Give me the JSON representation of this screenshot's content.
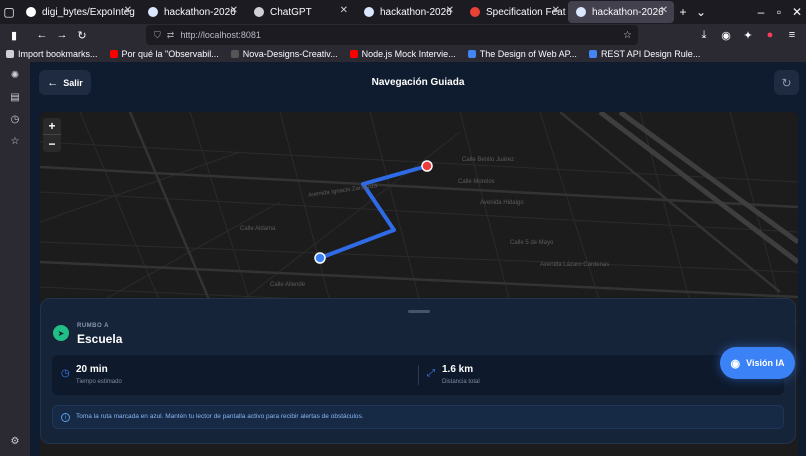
{
  "browser": {
    "tabs": [
      {
        "label": "digi_bytes/ExpoInteg",
        "icon": "github-icon",
        "color": "#ffffff"
      },
      {
        "label": "hackathon-2026",
        "icon": "app-icon",
        "color": "#dbe7ff"
      },
      {
        "label": "ChatGPT",
        "icon": "chatgpt-icon",
        "color": "#cfcfd8"
      },
      {
        "label": "hackathon-2026",
        "icon": "app-icon",
        "color": "#dbe7ff"
      },
      {
        "label": "Specification Feature",
        "icon": "gmail-icon",
        "color": "#ea4335"
      },
      {
        "label": "hackathon-2026",
        "icon": "app-icon",
        "color": "#dbe7ff"
      }
    ],
    "active_tab_index": 5,
    "url": "http://localhost:8081",
    "bookmarks": [
      {
        "label": "Import bookmarks...",
        "icon": "import-icon",
        "color": "#cfcfd8"
      },
      {
        "label": "Por qué la \"Observabil...",
        "icon": "youtube-icon",
        "color": "#ff0000"
      },
      {
        "label": "Nova-Designs-Creativ...",
        "icon": "github-icon",
        "color": "#555555"
      },
      {
        "label": "Node.js Mock Intervie...",
        "icon": "youtube-icon",
        "color": "#ff0000"
      },
      {
        "label": "The Design of Web AP...",
        "icon": "google-icon",
        "color": "#4285f4"
      },
      {
        "label": "REST API Design Rule...",
        "icon": "google-icon",
        "color": "#4285f4"
      }
    ]
  },
  "app": {
    "back_label": "Salir",
    "title": "Navegación Guiada",
    "zoom_in": "+",
    "zoom_out": "−",
    "destination": {
      "kicker": "RUMBO A",
      "name": "Escuela"
    },
    "stats": [
      {
        "value": "20 min",
        "label": "Tiempo estimado",
        "icon": "clock-icon"
      },
      {
        "value": "1.6 km",
        "label": "Distancia total",
        "icon": "arrows-icon"
      }
    ],
    "info_text": "Toma la ruta marcada en azul. Mantén tu lector de pantalla activo para recibir alertas de obstáculos.",
    "vision_label": "Visión IA",
    "map_labels": [
      "Avenida Ignacio Zaragoza",
      "Calle Benito Juárez",
      "Calle Morelos",
      "Avenida Hidalgo",
      "Calle 5 de Mayo",
      "Avenida Lázaro Cárdenas",
      "Calle Aldama",
      "Calle Allende"
    ],
    "colors": {
      "accent": "#3b82f6",
      "route": "#2f6be6",
      "origin": "#3b82f6",
      "destination": "#ef3b3b",
      "success": "#1fbf86"
    }
  }
}
